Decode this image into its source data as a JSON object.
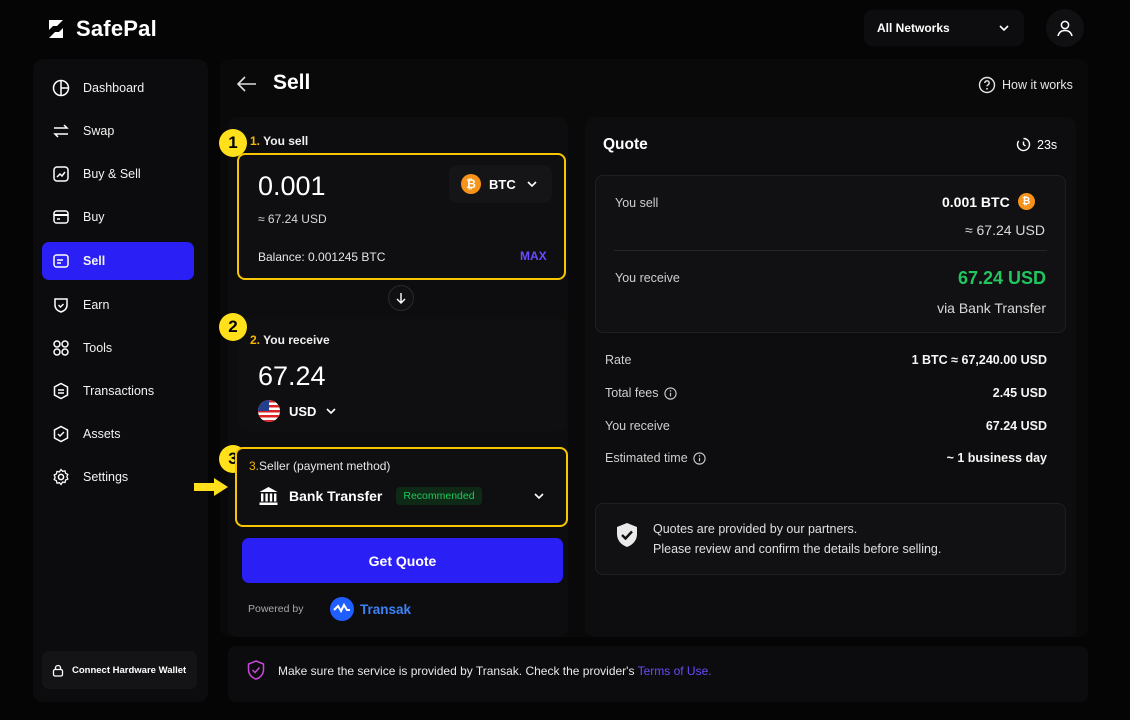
{
  "app": {
    "name": "SafePal"
  },
  "header": {
    "network": "All Networks"
  },
  "sidebar": {
    "items": [
      {
        "label": "Dashboard",
        "icon": "dashboard-icon"
      },
      {
        "label": "Swap",
        "icon": "swap-icon"
      },
      {
        "label": "Buy & Sell",
        "icon": "chart-icon"
      },
      {
        "label": "Buy",
        "icon": "card-icon"
      },
      {
        "label": "Sell",
        "icon": "wallet-card-icon",
        "active": true
      },
      {
        "label": "Earn",
        "icon": "shield-icon"
      },
      {
        "label": "Tools",
        "icon": "grid-icon"
      },
      {
        "label": "Transactions",
        "icon": "transactions-icon"
      },
      {
        "label": "Assets",
        "icon": "assets-icon"
      },
      {
        "label": "Settings",
        "icon": "gear-icon"
      }
    ],
    "hardware_wallet": "Connect Hardware Wallet"
  },
  "page": {
    "title": "Sell",
    "how_it_works": "How it works"
  },
  "sell_form": {
    "step1": {
      "badge": "1",
      "num": "1.",
      "label": "You sell"
    },
    "sell_amount": "0.001",
    "sell_usd": "≈ 67.24 USD",
    "coin": "BTC",
    "balance": "Balance: 0.001245 BTC",
    "max": "MAX",
    "step2": {
      "badge": "2",
      "num": "2.",
      "label": "You receive"
    },
    "receive_amount": "67.24",
    "fiat": "USD",
    "step3": {
      "badge": "3",
      "num": "3.",
      "label": "Seller (payment method)"
    },
    "payment_method": "Bank Transfer",
    "payment_badge": "Recommended",
    "submit": "Get Quote",
    "powered_by": "Powered by",
    "provider": "Transak"
  },
  "quote": {
    "title": "Quote",
    "timer": "23s",
    "you_sell_label": "You sell",
    "you_sell_value": "0.001 BTC",
    "you_sell_usd": "≈ 67.24 USD",
    "you_receive_label": "You receive",
    "you_receive_value": "67.24 USD",
    "via": "via Bank Transfer",
    "rows": [
      {
        "label": "Rate",
        "value": "1 BTC ≈ 67,240.00 USD"
      },
      {
        "label": "Total fees",
        "value": "2.45 USD"
      },
      {
        "label": "You receive",
        "value": "67.24 USD"
      },
      {
        "label": "Estimated time",
        "value": "~ 1 business day"
      }
    ],
    "notice_line1": "Quotes are provided by our partners.",
    "notice_line2": "Please review and confirm the details before selling."
  },
  "footer": {
    "text": "Make sure the service is provided by Transak. Check the provider's ",
    "link": "Terms of Use."
  },
  "colors": {
    "accent": "#2a1ff5",
    "highlight": "#f7c600",
    "success": "#22c55e",
    "btc": "#f7931a"
  }
}
